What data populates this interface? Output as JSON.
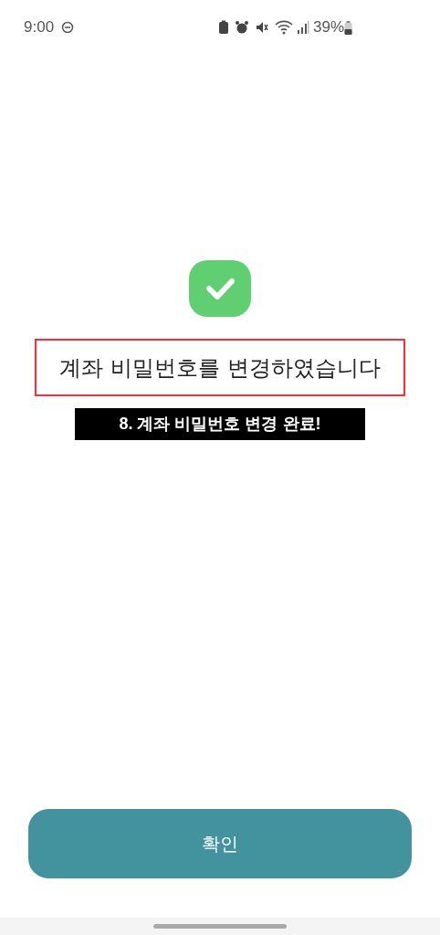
{
  "status_bar": {
    "time": "9:00",
    "battery": "39%"
  },
  "message": "계좌 비밀번호를 변경하였습니다",
  "caption": "8. 계좌 비밀번호 변경 완료!",
  "button": "확인"
}
